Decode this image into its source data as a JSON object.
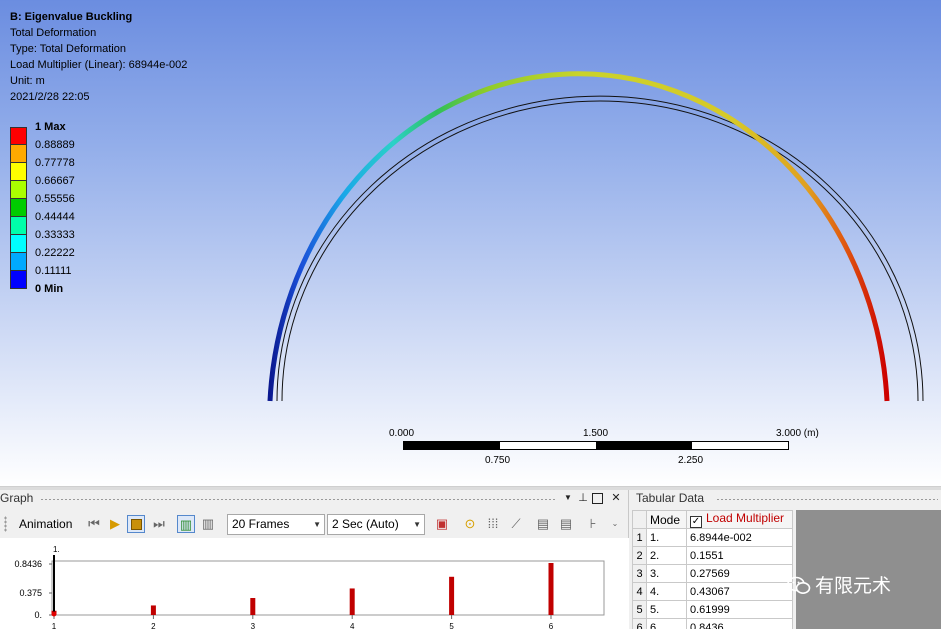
{
  "viewport": {
    "title": "B: Eigenvalue Buckling",
    "result": "Total Deformation",
    "type": "Type: Total Deformation",
    "load_multiplier": "Load Multiplier (Linear): 68944e-002",
    "unit": "Unit: m",
    "timestamp": "2021/2/28 22:05"
  },
  "legend": [
    {
      "label": "1 Max",
      "color": "#ff0000",
      "bold": true
    },
    {
      "label": "0.88889",
      "color": "#ffaa00"
    },
    {
      "label": "0.77778",
      "color": "#ffff00"
    },
    {
      "label": "0.66667",
      "color": "#aaff00"
    },
    {
      "label": "0.55556",
      "color": "#00cc00"
    },
    {
      "label": "0.44444",
      "color": "#00ffaa"
    },
    {
      "label": "0.33333",
      "color": "#00ffff"
    },
    {
      "label": "0.22222",
      "color": "#00aaff"
    },
    {
      "label": "0.11111",
      "color": "#0000ff"
    },
    {
      "label": "0 Min",
      "color": "",
      "bold": true
    }
  ],
  "scale_bar": {
    "top_labels": [
      "0.000",
      "1.500",
      "3.000 (m)"
    ],
    "bottom_labels": [
      "0.750",
      "2.250"
    ]
  },
  "graph": {
    "title": "Graph",
    "animation_label": "Animation",
    "frames": "20 Frames",
    "duration": "2 Sec (Auto)",
    "header_buttons": [
      "chevron-down",
      "pin",
      "maximize",
      "close"
    ]
  },
  "chart_data": {
    "type": "bar",
    "categories": [
      "1",
      "2",
      "3",
      "4",
      "5",
      "6"
    ],
    "values": [
      0.068944,
      0.1551,
      0.27569,
      0.43067,
      0.61999,
      0.8436
    ],
    "yticks": [
      "0.8436",
      "0.375",
      "0."
    ],
    "top_label": "1.",
    "ylim": [
      0,
      1
    ]
  },
  "tabular": {
    "title": "Tabular Data",
    "col_mode": "Mode",
    "col_value": "Load Multiplier",
    "rows": [
      {
        "idx": "1",
        "mode": "1.",
        "value": "6.8944e-002"
      },
      {
        "idx": "2",
        "mode": "2.",
        "value": "0.1551"
      },
      {
        "idx": "3",
        "mode": "3.",
        "value": "0.27569"
      },
      {
        "idx": "4",
        "mode": "4.",
        "value": "0.43067"
      },
      {
        "idx": "5",
        "mode": "5.",
        "value": "0.61999"
      },
      {
        "idx": "6",
        "mode": "6.",
        "value": "0.8436"
      }
    ]
  },
  "watermark": {
    "text": "有限元术"
  }
}
